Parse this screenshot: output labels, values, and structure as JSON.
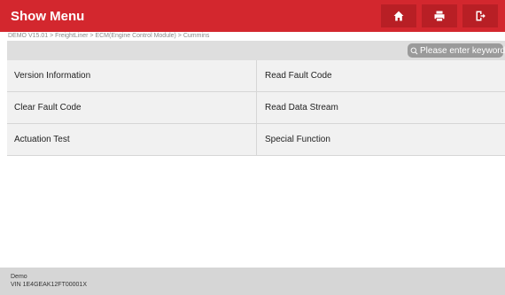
{
  "header": {
    "title": "Show Menu",
    "accent_color": "#d3272e",
    "buttons": [
      {
        "name": "home",
        "icon": "home-icon"
      },
      {
        "name": "print",
        "icon": "printer-icon"
      },
      {
        "name": "exit",
        "icon": "exit-icon"
      }
    ]
  },
  "breadcrumb": "DEMO V15.01 > FreightLiner > ECM(Engine Control Module) > Cummins",
  "search": {
    "placeholder": "Please enter keyword",
    "icon": "search-icon"
  },
  "menu": {
    "items": [
      "Version Information",
      "Read Fault Code",
      "Clear Fault Code",
      "Read Data Stream",
      "Actuation Test",
      "Special Function"
    ]
  },
  "footer": {
    "line1": "Demo",
    "line2": "VIN 1E4GEAK12FT00001X"
  }
}
